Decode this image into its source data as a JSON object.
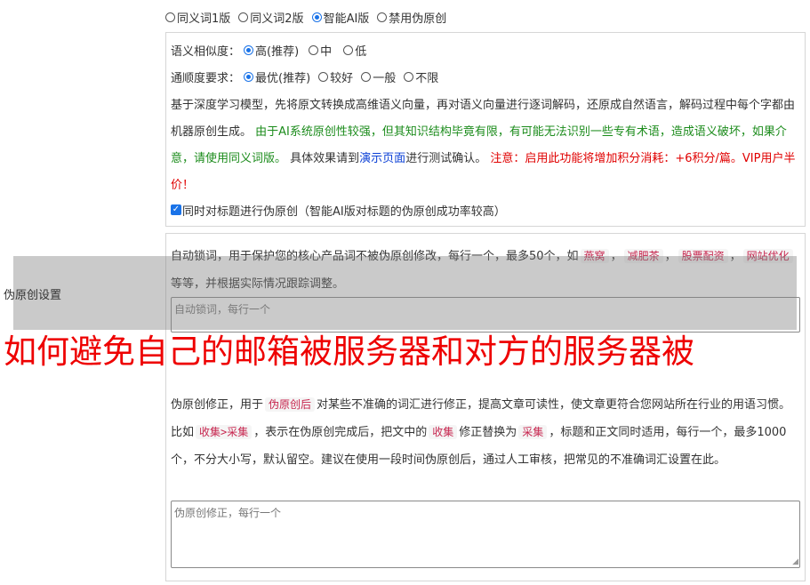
{
  "modes": [
    {
      "label": "同义词1版",
      "checked": false
    },
    {
      "label": "同义词2版",
      "checked": false
    },
    {
      "label": "智能AI版",
      "checked": true
    },
    {
      "label": "禁用伪原创",
      "checked": false
    }
  ],
  "similarity": {
    "label": "语义相似度：",
    "options": [
      {
        "label": "高(推荐)",
        "checked": true
      },
      {
        "label": "中",
        "checked": false
      },
      {
        "label": "低",
        "checked": false
      }
    ]
  },
  "fluency": {
    "label": "通顺度要求：",
    "options": [
      {
        "label": "最优(推荐)",
        "checked": true
      },
      {
        "label": "较好",
        "checked": false
      },
      {
        "label": "一般",
        "checked": false
      },
      {
        "label": "不限",
        "checked": false
      }
    ]
  },
  "description": {
    "part1": "基于深度学习模型，先将原文转换成高维语义向量，再对语义向量进行逐词解码，还原成自然语言，解码过程中每个字都由机器原创生成。",
    "part2_green": "由于AI系统原创性较强，但其知识结构毕竟有限，有可能无法识别一些专有术语，造成语义破坏，如果介意，请使用同义词版。",
    "part3": "具体效果请到",
    "demo_link": "演示页面",
    "part4": "进行测试确认。",
    "part5_red": "注意：启用此功能将增加积分消耗：+6积分/篇。VIP用户半价！"
  },
  "title_checkbox": {
    "checked": true,
    "label": "同时对标题进行伪原创（智能AI版对标题的伪原创成功率较高）"
  },
  "side_label": "伪原创设置",
  "lock_words": {
    "intro": "自动锁词，用于保护您的核心产品词不被伪原创修改，每行一个，最多50个，如",
    "examples": [
      "燕窝",
      "减肥茶",
      "股票配资",
      "网站优化"
    ],
    "suffix": "等等，并根据实际情况跟踪调整。",
    "placeholder": "自动锁词，每行一个"
  },
  "headline": "如何避免自己的邮箱被服务器和对方的服务器被",
  "correction": {
    "t1": "伪原创修正，用于",
    "tag1": "伪原创后",
    "t2": "对某些不准确的词汇进行修正，提高文章可读性，使文章更符合您网站所在行业的用语习惯。比如",
    "tag2": "收集>采集",
    "t3": "，表示在伪原创完成后，把文中的",
    "tag3": "收集",
    "t4": "修正替换为",
    "tag4": "采集",
    "t5": "，标题和正文同时适用，每行一个，最多1000个，不分大小写，默认留空。建议在使用一段时间伪原创后，通过人工审核，把常见的不准确词汇设置在此。",
    "placeholder": "伪原创修正，每行一个"
  }
}
